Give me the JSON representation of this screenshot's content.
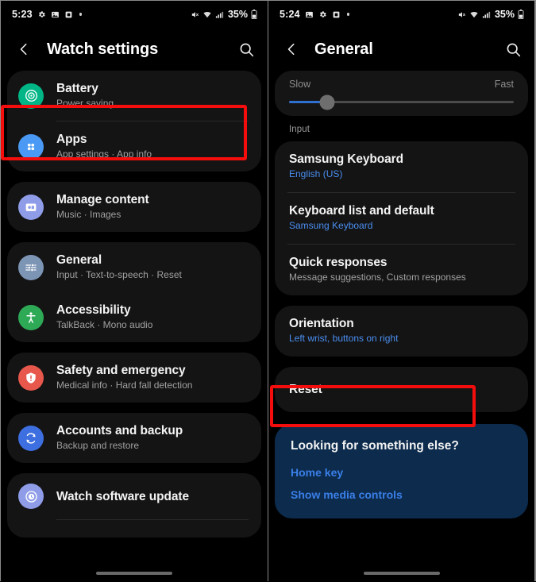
{
  "colors": {
    "accent_blue": "#4a8ef0",
    "highlight_red": "#f30d0d",
    "promo_bg": "#0c2b4d",
    "card_bg": "#141414",
    "battery_icon": "#00b686",
    "apps_icon": "#4a9af5",
    "manage_icon": "#8f9ce8",
    "general_icon": "#7d95b5",
    "accessibility_icon": "#2eaa57",
    "safety_icon": "#e8574c",
    "accounts_icon": "#3d6fe0",
    "update_icon": "#8f9ce8"
  },
  "left_screen": {
    "statusbar": {
      "time": "5:23",
      "icons": [
        "gear-icon",
        "image-icon",
        "square-icon",
        "dot-icon"
      ],
      "right_icons": [
        "mute-icon",
        "wifi-icon",
        "signal-icon"
      ],
      "battery": "35%"
    },
    "appbar": {
      "back": "back-icon",
      "title": "Watch settings",
      "search": "search-icon"
    },
    "groups": [
      {
        "items": [
          {
            "icon": "battery-icon",
            "icon_color": "#00b686",
            "title": "Battery",
            "subtitle": "Power saving",
            "divider": true
          },
          {
            "icon": "apps-icon",
            "icon_color": "#4a9af5",
            "title": "Apps",
            "subtitle": "App settings · App info",
            "divider": false
          }
        ]
      },
      {
        "items": [
          {
            "icon": "manage-content-icon",
            "icon_color": "#8f9ce8",
            "title": "Manage content",
            "subtitle": "Music · Images",
            "divider": false
          }
        ]
      },
      {
        "items": [
          {
            "icon": "general-icon",
            "icon_color": "#7d95b5",
            "title": "General",
            "subtitle": "Input · Text-to-speech · Reset",
            "divider": false,
            "highlighted": true
          },
          {
            "icon": "accessibility-icon",
            "icon_color": "#2eaa57",
            "title": "Accessibility",
            "subtitle": "TalkBack · Mono audio",
            "divider": false
          }
        ]
      },
      {
        "items": [
          {
            "icon": "safety-icon",
            "icon_color": "#e8574c",
            "title": "Safety and emergency",
            "subtitle": "Medical info · Hard fall detection",
            "divider": false
          }
        ]
      },
      {
        "items": [
          {
            "icon": "accounts-icon",
            "icon_color": "#3d6fe0",
            "title": "Accounts and backup",
            "subtitle": "Backup and restore",
            "divider": false
          }
        ]
      },
      {
        "items": [
          {
            "icon": "watch-update-icon",
            "icon_color": "#8f9ce8",
            "title": "Watch software update",
            "subtitle": "",
            "divider": true
          }
        ]
      }
    ]
  },
  "right_screen": {
    "statusbar": {
      "time": "5:24",
      "icons": [
        "image-icon",
        "gear-icon",
        "square-icon",
        "dot-icon"
      ],
      "right_icons": [
        "mute-icon",
        "wifi-icon",
        "signal-icon"
      ],
      "battery": "35%"
    },
    "appbar": {
      "back": "back-icon",
      "title": "General",
      "search": "search-icon"
    },
    "slider": {
      "min_label": "Slow",
      "max_label": "Fast",
      "value_percent": 17
    },
    "section_label": "Input",
    "input_items": [
      {
        "title": "Samsung Keyboard",
        "subtitle": "English (US)",
        "subtitle_is_link": true,
        "divider": true
      },
      {
        "title": "Keyboard list and default",
        "subtitle": "Samsung Keyboard",
        "subtitle_is_link": true,
        "divider": true
      },
      {
        "title": "Quick responses",
        "subtitle": "Message suggestions, Custom responses",
        "subtitle_is_link": false,
        "divider": false
      }
    ],
    "orientation_item": {
      "title": "Orientation",
      "subtitle": "Left wrist, buttons on right",
      "subtitle_is_link": true
    },
    "reset_item": {
      "title": "Reset",
      "subtitle": "",
      "highlighted": true
    },
    "promo": {
      "title": "Looking for something else?",
      "links": [
        "Home key",
        "Show media controls"
      ]
    }
  }
}
